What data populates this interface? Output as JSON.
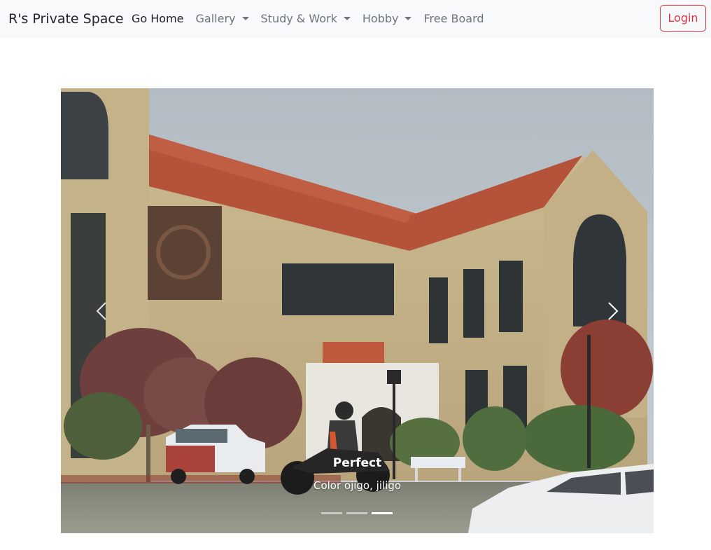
{
  "navbar": {
    "brand": "R's Private Space",
    "items": [
      {
        "label": "Go Home",
        "dropdown": false,
        "active": true
      },
      {
        "label": "Gallery",
        "dropdown": true,
        "active": false
      },
      {
        "label": "Study & Work",
        "dropdown": true,
        "active": false
      },
      {
        "label": "Hobby",
        "dropdown": true,
        "active": false
      },
      {
        "label": "Free Board",
        "dropdown": false,
        "active": false
      }
    ],
    "login_label": "Login"
  },
  "carousel": {
    "slide_count": 3,
    "active_slide": 3,
    "caption_title": "Perfect",
    "caption_text": "Color ojigo, jiligo",
    "prev_icon": "chevron-left-icon",
    "next_icon": "chevron-right-icon"
  },
  "colors": {
    "navbar_bg": "#f8f9fa",
    "login_border": "#dc3545",
    "nav_text": "#6c757d",
    "nav_active_text": "#212529"
  }
}
